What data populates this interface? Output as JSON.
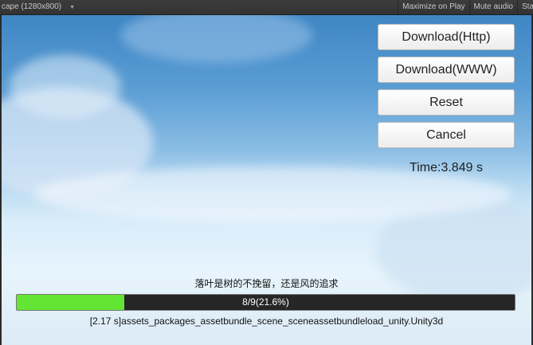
{
  "toolbar": {
    "aspect_label": "cape (1280x800)",
    "maximize_label": "Maximize on Play",
    "mute_label": "Mute audio",
    "stats_label": "Stats"
  },
  "buttons": {
    "download_http": "Download(Http)",
    "download_www": "Download(WWW)",
    "reset": "Reset",
    "cancel": "Cancel"
  },
  "time_text": "Time:3.849 s",
  "status_text": "落叶是树的不挽留，还是风的追求",
  "progress": {
    "fraction": 0.216,
    "text": "8/9(21.6%)",
    "fill_color": "#62e633"
  },
  "file_text": "[2.17 s]assets_packages_assetbundle_scene_sceneassetbundleload_unity.Unity3d",
  "icons": {
    "dropdown": "chevron-down-icon"
  }
}
